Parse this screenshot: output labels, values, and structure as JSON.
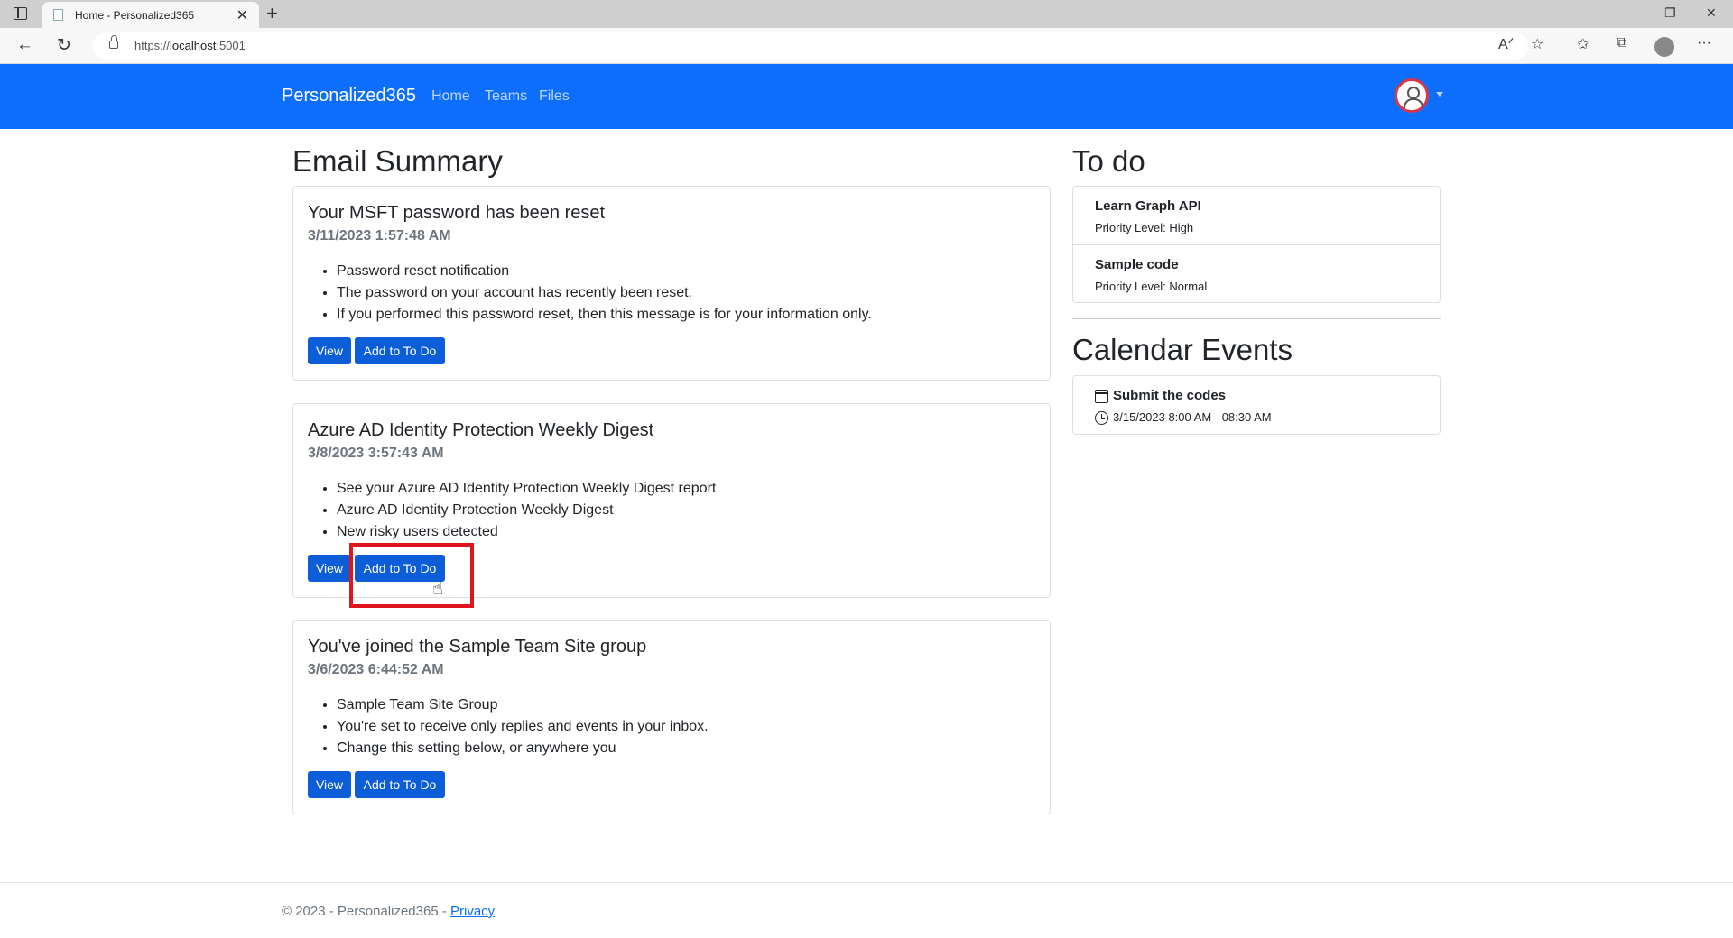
{
  "browser": {
    "tab_title": "Home - Personalized365",
    "url_prefix": "https://",
    "url_host": "localhost",
    "url_port": ":5001"
  },
  "nav": {
    "brand": "Personalized365",
    "links": [
      "Home",
      "Teams",
      "Files"
    ]
  },
  "email_summary": {
    "heading": "Email Summary",
    "emails": [
      {
        "subject": "Your MSFT password has been reset",
        "date": "3/11/2023 1:57:48 AM",
        "bullets": [
          "Password reset notification",
          "The password on your account has recently been reset.",
          "If you performed this password reset, then this message is for your information only."
        ]
      },
      {
        "subject": "Azure AD Identity Protection Weekly Digest",
        "date": "3/8/2023 3:57:43 AM",
        "bullets": [
          "See your Azure AD Identity Protection Weekly Digest report",
          "Azure AD Identity Protection Weekly Digest",
          "New risky users detected"
        ]
      },
      {
        "subject": "You've joined the Sample Team Site group",
        "date": "3/6/2023 6:44:52 AM",
        "bullets": [
          "Sample Team Site Group",
          "You're set to receive only replies and events in your inbox.",
          "Change this setting below, or anywhere you"
        ]
      }
    ],
    "view_label": "View",
    "add_label": "Add to To Do"
  },
  "todo": {
    "heading": "To do",
    "items": [
      {
        "title": "Learn Graph API",
        "priority": "Priority Level: High"
      },
      {
        "title": "Sample code",
        "priority": "Priority Level: Normal"
      }
    ]
  },
  "calendar": {
    "heading": "Calendar Events",
    "events": [
      {
        "title": "Submit the codes",
        "time": "3/15/2023 8:00 AM - 08:30 AM"
      }
    ]
  },
  "footer": {
    "text": "© 2023 - Personalized365 - ",
    "privacy": "Privacy"
  },
  "colors": {
    "navbar": "#0d6efd",
    "button": "#0b5ed7",
    "highlight": "#e0141e"
  }
}
